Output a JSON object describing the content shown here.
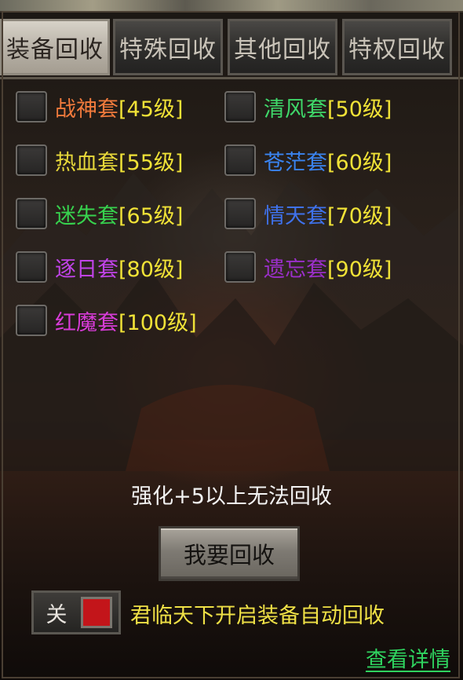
{
  "tabs": [
    {
      "label": "装备回收",
      "active": true
    },
    {
      "label": "特殊回收",
      "active": false
    },
    {
      "label": "其他回收",
      "active": false
    },
    {
      "label": "特权回收",
      "active": false
    }
  ],
  "items": [
    {
      "name": "战神套",
      "level": "[45级]",
      "color": "#f07a3c",
      "checked": false
    },
    {
      "name": "清风套",
      "level": "[50级]",
      "color": "#3fd86a",
      "checked": false
    },
    {
      "name": "热血套",
      "level": "[55级]",
      "color": "#e7d83a",
      "checked": false
    },
    {
      "name": "苍茫套",
      "level": "[60级]",
      "color": "#3a84f0",
      "checked": false
    },
    {
      "name": "迷失套",
      "level": "[65级]",
      "color": "#37d24e",
      "checked": false
    },
    {
      "name": "情天套",
      "level": "[70级]",
      "color": "#3f72ec",
      "checked": false
    },
    {
      "name": "逐日套",
      "level": "[80级]",
      "color": "#c043e8",
      "checked": false
    },
    {
      "name": "遗忘套",
      "level": "[90级]",
      "color": "#9a2fc8",
      "checked": false
    },
    {
      "name": "红魔套",
      "level": "[100级]",
      "color": "#d83cd8",
      "checked": false
    }
  ],
  "notice": "强化+5以上无法回收",
  "recycle_button": "我要回收",
  "auto_toggle": {
    "label": "关",
    "state": "off",
    "knob_color": "#c3151a"
  },
  "auto_text": "君临天下开启装备自动回收",
  "details_link": "查看详情"
}
